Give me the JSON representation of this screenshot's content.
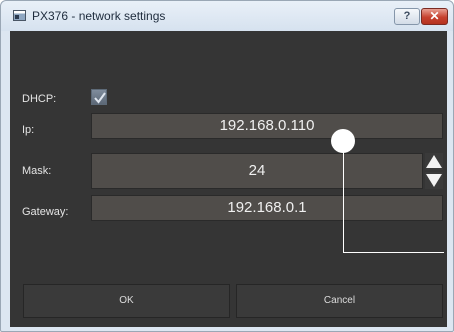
{
  "window": {
    "title": "PX376 - network settings",
    "help_label": "?",
    "close_label": "✕"
  },
  "form": {
    "dhcp_label": "DHCP:",
    "dhcp_checked": true,
    "ip_label": "Ip:",
    "ip_value": "192.168.0.110",
    "mask_label": "Mask:",
    "mask_value": "24",
    "gateway_label": "Gateway:",
    "gateway_value": "192.168.0.1"
  },
  "buttons": {
    "ok_label": "OK",
    "cancel_label": "Cancel"
  },
  "colors": {
    "panel_bg": "#353535",
    "field_bg": "#504d4a",
    "title_bar": "#dce6f1",
    "close_red": "#c6412f"
  },
  "icons": [
    "app-icon",
    "help-icon",
    "close-icon",
    "checkmark-icon",
    "spin-up-icon",
    "spin-down-icon"
  ]
}
